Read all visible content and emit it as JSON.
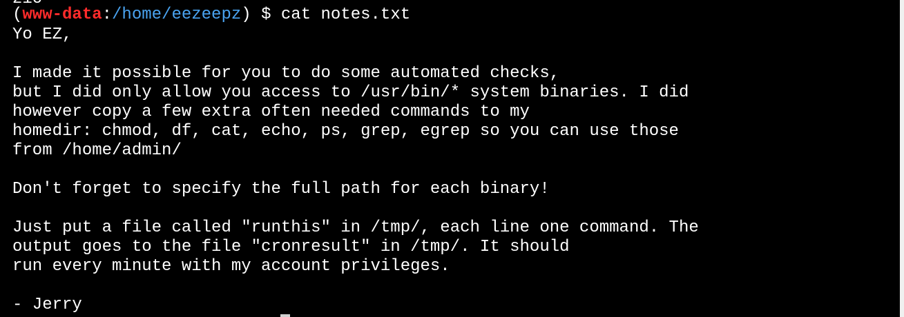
{
  "terminal": {
    "clipped_line": "zio",
    "prompt": {
      "open_paren": "(",
      "user": "www-data",
      "colon": ":",
      "path": "/home/eezeepz",
      "close_paren": ")",
      "symbol": " $ ",
      "command": "cat notes.txt"
    },
    "output": [
      "Yo EZ,",
      "",
      "I made it possible for you to do some automated checks,",
      "but I did only allow you access to /usr/bin/* system binaries. I did",
      "however copy a few extra often needed commands to my",
      "homedir: chmod, df, cat, echo, ps, grep, egrep so you can use those",
      "from /home/admin/",
      "",
      "Don't forget to specify the full path for each binary!",
      "",
      "Just put a file called \"runthis\" in /tmp/, each line one command. The",
      "output goes to the file \"cronresult\" in /tmp/. It should",
      "run every minute with my account privileges.",
      "",
      "- Jerry"
    ]
  },
  "colors": {
    "background": "#000000",
    "text": "#ffffff",
    "user": "#ff2b2b",
    "path": "#4aa3f0"
  }
}
